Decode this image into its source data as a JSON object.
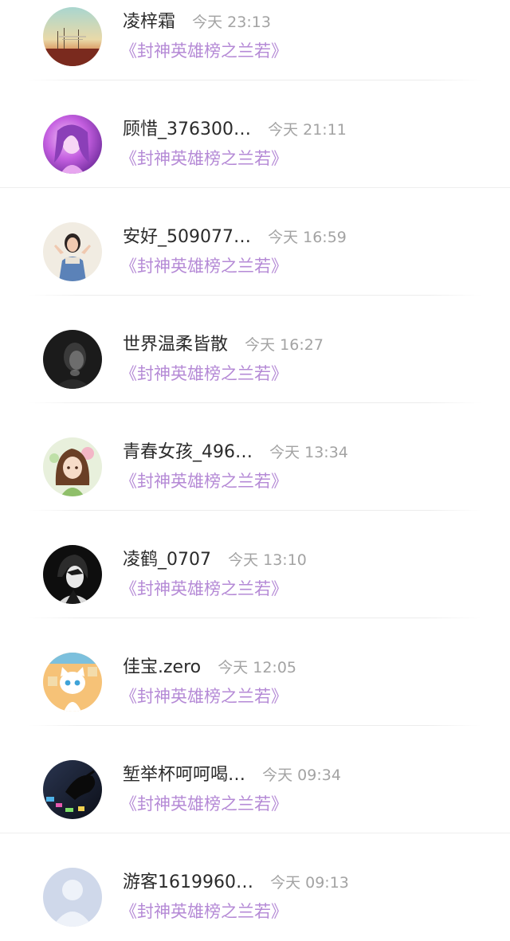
{
  "comments": [
    {
      "name": "凌梓霜",
      "time": "今天 23:13",
      "book": "《封神英雄榜之兰若》",
      "avatar": "landscape-avatar"
    },
    {
      "name": "顾惜_376300…",
      "time": "今天 21:11",
      "book": "《封神英雄榜之兰若》",
      "avatar": "purple-girl-avatar"
    },
    {
      "name": "安好_509077…",
      "time": "今天 16:59",
      "book": "《封神英雄榜之兰若》",
      "avatar": "girl-photo-avatar"
    },
    {
      "name": "世界温柔皆散",
      "time": "今天 16:27",
      "book": "《封神英雄榜之兰若》",
      "avatar": "dark-portrait-avatar"
    },
    {
      "name": "青春女孩_496…",
      "time": "今天 13:34",
      "book": "《封神英雄榜之兰若》",
      "avatar": "anime-girl-avatar"
    },
    {
      "name": "凌鹤_0707",
      "time": "今天 13:10",
      "book": "《封神英雄榜之兰若》",
      "avatar": "anime-boy-avatar"
    },
    {
      "name": "佳宝.zero",
      "time": "今天 12:05",
      "book": "《封神英雄榜之兰若》",
      "avatar": "cartoon-cat-avatar"
    },
    {
      "name": "堑举杯呵呵喝…",
      "time": "今天 09:34",
      "book": "《封神英雄榜之兰若》",
      "avatar": "night-hand-avatar"
    },
    {
      "name": "游客1619960…",
      "time": "今天 09:13",
      "book": "《封神英雄榜之兰若》",
      "avatar": "default-user-avatar"
    }
  ]
}
